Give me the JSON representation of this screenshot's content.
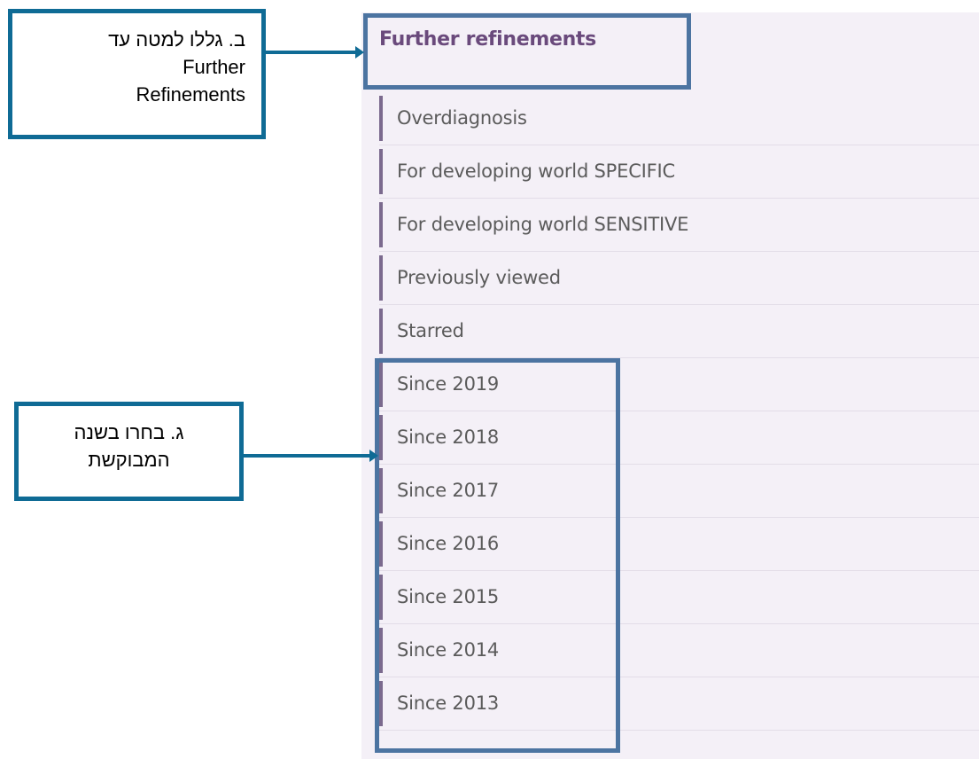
{
  "panel": {
    "heading": "Further refinements",
    "items": [
      {
        "label": "Overdiagnosis"
      },
      {
        "label": "For developing world SPECIFIC"
      },
      {
        "label": "For developing world SENSITIVE"
      },
      {
        "label": "Previously viewed"
      },
      {
        "label": "Starred"
      },
      {
        "label": "Since 2019"
      },
      {
        "label": "Since 2018"
      },
      {
        "label": "Since 2017"
      },
      {
        "label": "Since 2016"
      },
      {
        "label": "Since 2015"
      },
      {
        "label": "Since 2014"
      },
      {
        "label": "Since 2013"
      }
    ]
  },
  "annotations": {
    "callout_b": {
      "line1": "ב. גללו למטה עד",
      "line2": "Further",
      "line3": "Refinements"
    },
    "callout_g": {
      "line1": "ג. בחרו בשנה",
      "line2": "המבוקשת"
    }
  },
  "colors": {
    "panel_background": "#f4f0f7",
    "heading_text": "#6a4a7c",
    "item_accent_bar": "#7b6a8e",
    "item_text": "#5b5b5b",
    "highlight_box": "#4c74a1",
    "callout_border": "#0f6b95"
  }
}
